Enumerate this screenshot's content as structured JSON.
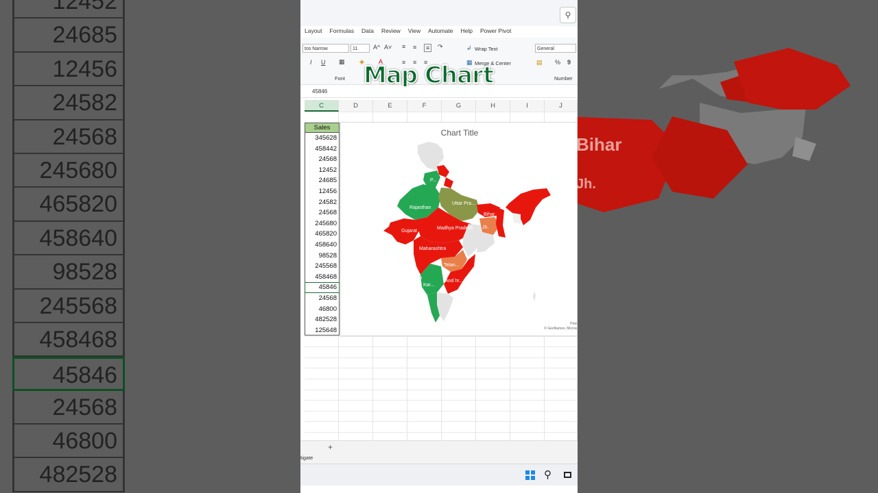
{
  "background_left": {
    "values": [
      "12452",
      "24685",
      "12456",
      "24582",
      "24568",
      "245680",
      "465820",
      "458640",
      "98528",
      "245568",
      "458468",
      "45846",
      "24568",
      "46800",
      "482528"
    ],
    "selected_index": 11
  },
  "background_right": {
    "labels": [
      "Bihar",
      "Jh."
    ]
  },
  "ribbon": {
    "tabs": [
      "Layout",
      "Formulas",
      "Data",
      "Review",
      "View",
      "Automate",
      "Help",
      "Power Pivot"
    ],
    "font_name": "tos Narrow",
    "font_size": "11",
    "grow_font": "A^",
    "shrink_font": "A˅",
    "italic": "I",
    "underline": "U",
    "wrap_text": "Wrap Text",
    "merge_center": "Merge & Center",
    "number_format": "General",
    "percent": "%",
    "comma": "9",
    "font_group": "Font",
    "number_group": "Number"
  },
  "overlay_title": "Map Chart",
  "formula_bar": {
    "value": "45846"
  },
  "columns": [
    "C",
    "D",
    "E",
    "F",
    "G",
    "H",
    "I",
    "J"
  ],
  "active_column": "C",
  "sales": {
    "header": "Sales",
    "values": [
      "345628",
      "458442",
      "24568",
      "12452",
      "24685",
      "12456",
      "24582",
      "24568",
      "245680",
      "465820",
      "458640",
      "98528",
      "245568",
      "458468",
      "45846",
      "24568",
      "46800",
      "482528",
      "125648"
    ],
    "selected_index": 14
  },
  "chart": {
    "title": "Chart Title",
    "attribution_line1": "Pow",
    "attribution_line2": "© GeoNames, Micros",
    "region_labels": [
      "P...",
      "Rajasthan",
      "Uttar Pra...",
      "Bihar",
      "Jh.",
      "Gujarat",
      "Madhya Pradesh",
      "Maharashtra",
      "Telan...",
      "And hr...",
      "Kar..."
    ],
    "colors": {
      "high": "#e8170e",
      "mid": "#8b9748",
      "low": "#25a853",
      "orange": "#e97f4a",
      "none": "#e3e3e3"
    }
  },
  "sheet": {
    "add_label": "+"
  },
  "status": {
    "text": "tigate"
  }
}
